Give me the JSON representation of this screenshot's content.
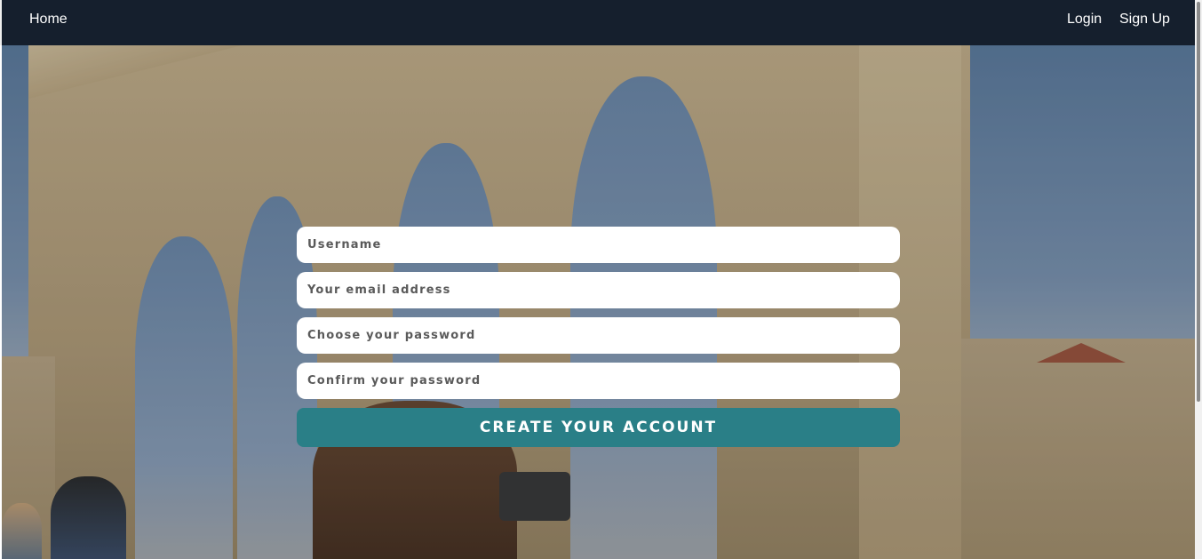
{
  "nav": {
    "home_label": "Home",
    "login_label": "Login",
    "signup_label": "Sign Up"
  },
  "form": {
    "username_placeholder": "Username",
    "email_placeholder": "Your email address",
    "password_placeholder": "Choose your password",
    "confirm_placeholder": "Confirm your password",
    "submit_label": "CREATE YOUR ACCOUNT"
  },
  "colors": {
    "navbar": "#151f2d",
    "button": "#2a7f87"
  }
}
